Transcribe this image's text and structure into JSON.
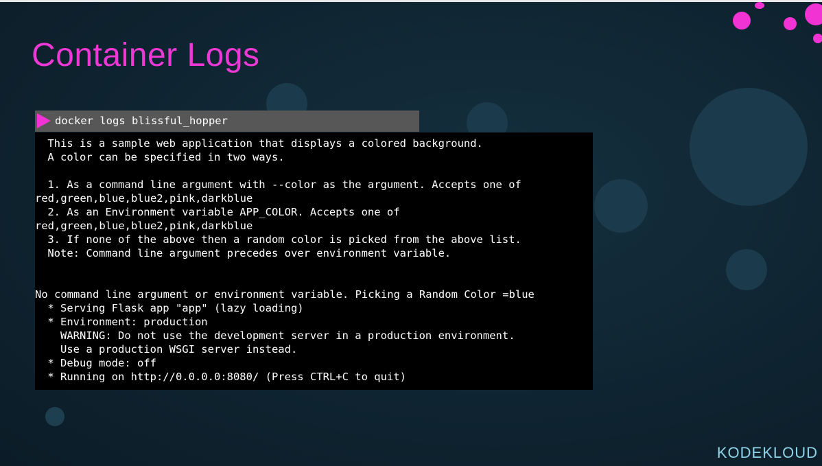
{
  "slide": {
    "title": "Container Logs",
    "brand": "KODEKLOUD"
  },
  "command_bar": {
    "icon": "play-triangle-icon",
    "command": "docker logs blissful_hopper"
  },
  "terminal": {
    "lines": [
      " This is a sample web application that displays a colored background.",
      " A color can be specified in two ways.",
      "",
      " 1. As a command line argument with --color as the argument. Accepts one of",
      "red,green,blue,blue2,pink,darkblue",
      " 2. As an Environment variable APP_COLOR. Accepts one of",
      "red,green,blue,blue2,pink,darkblue",
      " 3. If none of the above then a random color is picked from the above list.",
      " Note: Command line argument precedes over environment variable.",
      "",
      "",
      "No command line argument or environment variable. Picking a Random Color =blue",
      " * Serving Flask app \"app\" (lazy loading)",
      " * Environment: production",
      "   WARNING: Do not use the development server in a production environment.",
      "   Use a production WSGI server instead.",
      " * Debug mode: off",
      " * Running on http://0.0.0.0:8080/ (Press CTRL+C to quit)"
    ]
  },
  "colors": {
    "title": "#ec38d4",
    "accent": "#f033d2",
    "background": "#0f2431",
    "command_bar": "#575757",
    "terminal": "#000000"
  }
}
